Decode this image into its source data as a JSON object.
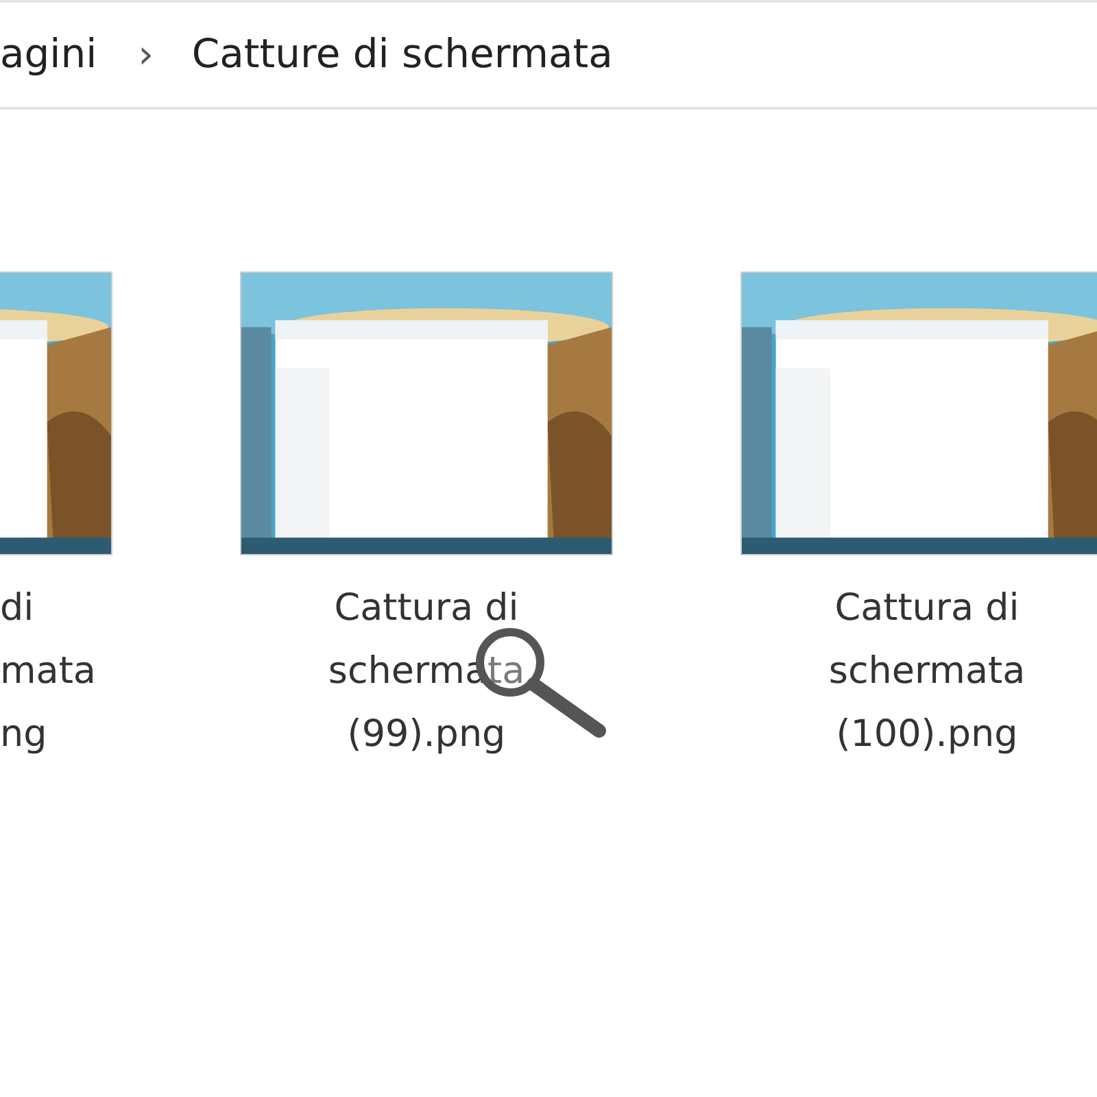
{
  "breadcrumb": [
    {
      "label": "agini"
    },
    {
      "label": "Catture di schermata"
    }
  ],
  "separator": "›",
  "files": [
    {
      "kind": "picture",
      "label_lines": [
        "di",
        "mata",
        "ng"
      ],
      "hovered": false
    },
    {
      "kind": "picture",
      "label_lines": [
        "Cattura di",
        "schermata",
        "(99).png"
      ],
      "hovered": true
    },
    {
      "kind": "picture",
      "label_lines": [
        "Cattura di",
        "schermata",
        "(100).png"
      ],
      "hovered": false
    }
  ]
}
